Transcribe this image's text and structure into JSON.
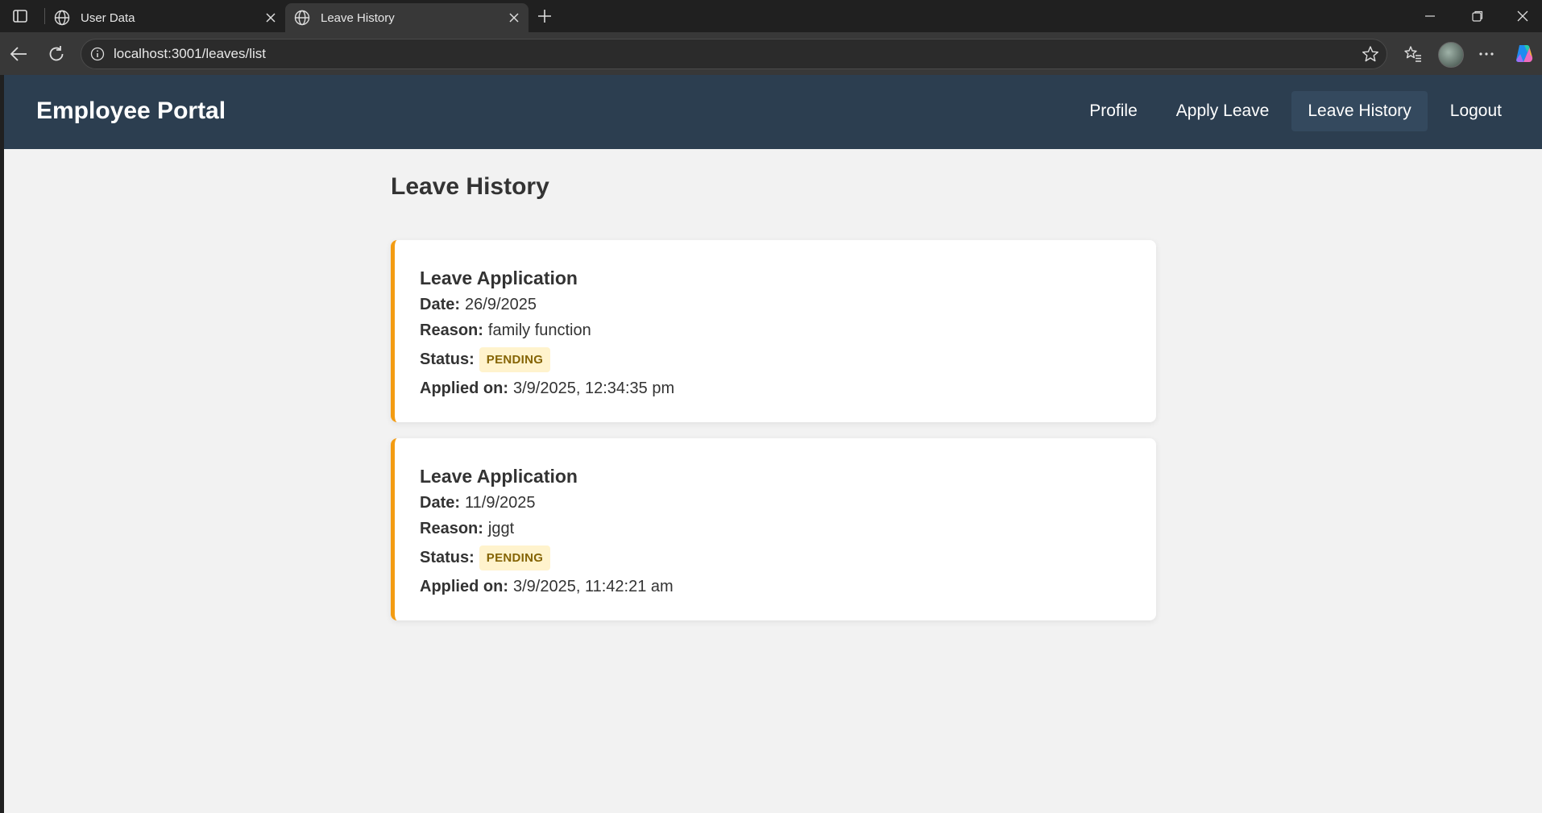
{
  "browser": {
    "tabs": [
      {
        "title": "User Data",
        "active": false
      },
      {
        "title": "Leave History",
        "active": true
      }
    ],
    "url": "localhost:3001/leaves/list"
  },
  "navbar": {
    "brand": "Employee Portal",
    "links": [
      {
        "label": "Profile",
        "active": false
      },
      {
        "label": "Apply Leave",
        "active": false
      },
      {
        "label": "Leave History",
        "active": true
      },
      {
        "label": "Logout",
        "active": false
      }
    ]
  },
  "page": {
    "title": "Leave History",
    "labels": {
      "date": "Date:",
      "reason": "Reason:",
      "status": "Status:",
      "applied_on": "Applied on:"
    },
    "leaves": [
      {
        "title": "Leave Application",
        "date": "26/9/2025",
        "reason": "family function",
        "status": "PENDING",
        "applied_on": "3/9/2025, 12:34:35 pm"
      },
      {
        "title": "Leave Application",
        "date": "11/9/2025",
        "reason": "jggt",
        "status": "PENDING",
        "applied_on": "3/9/2025, 11:42:21 am"
      }
    ]
  },
  "colors": {
    "navbar": "#2c3e50",
    "pending_border": "#f39c12",
    "pending_badge_bg": "#fff3cd",
    "pending_badge_text": "#856404"
  }
}
